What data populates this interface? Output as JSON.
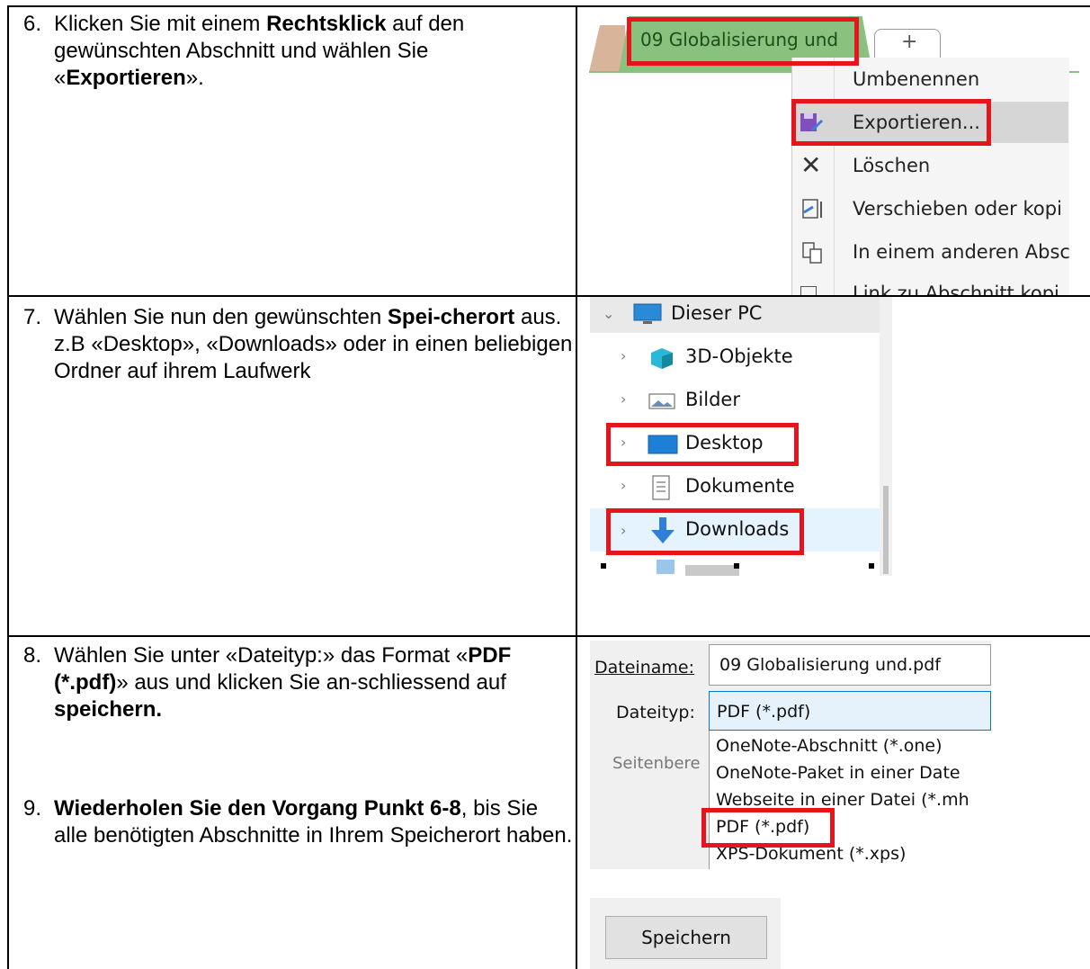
{
  "steps": [
    {
      "num": "6.",
      "parts": [
        "Klicken Sie mit einem ",
        "Rechtsklick",
        " auf den gewünschten Abschnitt und wählen Sie «",
        "Exportieren",
        "»."
      ]
    },
    {
      "num": "7.",
      "parts": [
        "Wählen Sie nun den gewünschten ",
        "Spei-cherort",
        " aus. z.B «Desktop», «Downloads» oder in einen beliebigen Ordner auf ihrem Laufwerk"
      ]
    },
    {
      "num": "8.",
      "parts": [
        "Wählen Sie unter «Dateityp:» das Format «",
        "PDF (*.pdf)",
        "» aus und klicken Sie an-schliessend auf ",
        "speichern."
      ]
    },
    {
      "num": "9.",
      "parts": [
        "Wiederholen Sie den Vorgang Punkt 6-8",
        ", bis Sie alle benötigten Abschnitte in Ihrem Speicherort haben."
      ]
    }
  ],
  "onenote": {
    "active_tab": "09 Globalisierung und",
    "add_tab": "+",
    "menu": {
      "rename": "Umbenennen",
      "export": "Exportieren...",
      "delete": "Löschen",
      "move": "Verschieben oder kopi",
      "merge": "In einem anderen Absc",
      "link": "Link zu Abschnitt kopi"
    }
  },
  "explorer": {
    "this_pc": "Dieser PC",
    "items": [
      "3D-Objekte",
      "Bilder",
      "Desktop",
      "Dokumente",
      "Downloads"
    ]
  },
  "save_dialog": {
    "filename_label": "Dateiname:",
    "filename_value": "09 Globalisierung und.pdf",
    "filetype_label": "Dateityp:",
    "filetype_value": "PDF (*.pdf)",
    "pages_label": "Seitenbere",
    "options": [
      "OneNote-Abschnitt (*.one)",
      "OneNote-Paket in einer Date",
      "Webseite in einer Datei (*.mh",
      "PDF (*.pdf)",
      "XPS-Dokument (*.xps)"
    ],
    "save_button": "Speichern"
  },
  "colors": {
    "highlight_red": "#e8141b",
    "tab_green": "#88c27e",
    "selection_blue": "#cce8ff"
  }
}
